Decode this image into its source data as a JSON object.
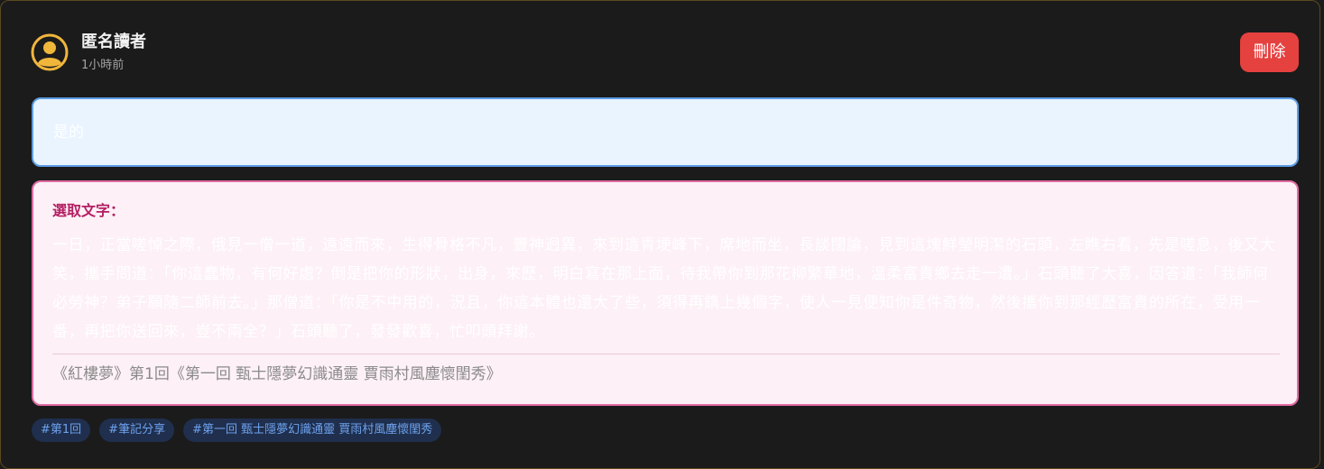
{
  "author": {
    "name": "匿名讀者",
    "time": "1小時前"
  },
  "actions": {
    "delete_label": "刪除"
  },
  "comment": {
    "text": "是的"
  },
  "quote": {
    "label": "選取文字：",
    "text": "一日，正當嗟悼之際，俄見一僧一道，遠遠而來，生得骨格不凡，豐神迥異，來到這青埂峰下，席地而坐，長談闊論，見到這塊鮮瑩明潔的石頭，左瞧右看，先是嗟息，後又大笑，攜手問道：「你這蠢物，有何好處？倒是把你的形狀，出身，來歷，明白寫在那上面，待我帶你到那花柳繁華地，溫柔富貴鄉去走一遭。」石頭聽了大喜，因答道：「我師何必勞神？弟子願隨二師前去。」那僧道：「你是不中用的，況且，你這本體也還大了些，須得再鐫上幾個字，使人一見便知你是件奇物，然後攜你到那經歷富貴的所在，受用一番，再把你送回來，豈不兩全？」石頭聽了，發發歡喜，忙叩頭拜謝。",
    "source": "《紅樓夢》第1回《第一回 甄士隱夢幻識通靈 賈雨村風塵懷閨秀》"
  },
  "tags": [
    "#第1回",
    "#筆記分享",
    "#第一回 甄士隱夢幻識通靈 賈雨村風塵懷閨秀"
  ],
  "colors": {
    "background": "#1b1b1b",
    "avatar": "#f0b63c",
    "delete": "#e5413f",
    "comment_bg": "#e9f4ff",
    "comment_border": "#5d9ee6",
    "quote_bg": "#fdf0f6",
    "quote_border": "#e16aa2",
    "quote_label": "#b41f63",
    "tag_bg": "#1f2f4d",
    "tag_text": "#6ea2ee"
  },
  "icons": {
    "avatar": "user-circle-icon"
  }
}
